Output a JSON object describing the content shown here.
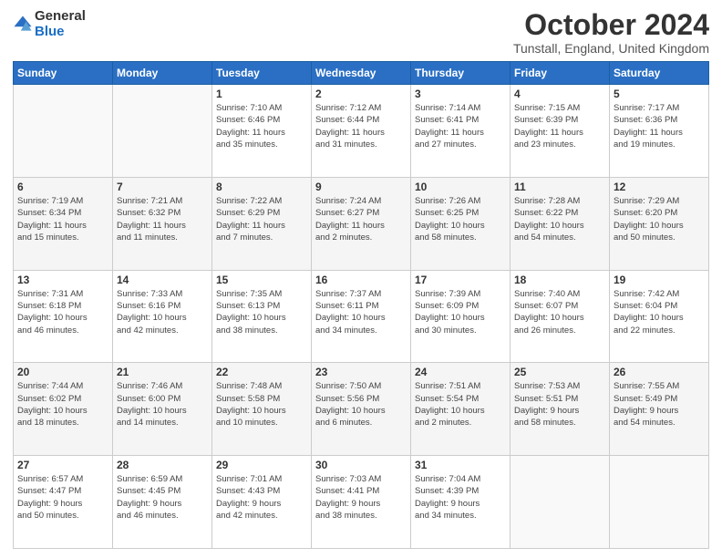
{
  "logo": {
    "general": "General",
    "blue": "Blue"
  },
  "title": "October 2024",
  "subtitle": "Tunstall, England, United Kingdom",
  "days_of_week": [
    "Sunday",
    "Monday",
    "Tuesday",
    "Wednesday",
    "Thursday",
    "Friday",
    "Saturday"
  ],
  "weeks": [
    [
      {
        "day": "",
        "info": ""
      },
      {
        "day": "",
        "info": ""
      },
      {
        "day": "1",
        "info": "Sunrise: 7:10 AM\nSunset: 6:46 PM\nDaylight: 11 hours\nand 35 minutes."
      },
      {
        "day": "2",
        "info": "Sunrise: 7:12 AM\nSunset: 6:44 PM\nDaylight: 11 hours\nand 31 minutes."
      },
      {
        "day": "3",
        "info": "Sunrise: 7:14 AM\nSunset: 6:41 PM\nDaylight: 11 hours\nand 27 minutes."
      },
      {
        "day": "4",
        "info": "Sunrise: 7:15 AM\nSunset: 6:39 PM\nDaylight: 11 hours\nand 23 minutes."
      },
      {
        "day": "5",
        "info": "Sunrise: 7:17 AM\nSunset: 6:36 PM\nDaylight: 11 hours\nand 19 minutes."
      }
    ],
    [
      {
        "day": "6",
        "info": "Sunrise: 7:19 AM\nSunset: 6:34 PM\nDaylight: 11 hours\nand 15 minutes."
      },
      {
        "day": "7",
        "info": "Sunrise: 7:21 AM\nSunset: 6:32 PM\nDaylight: 11 hours\nand 11 minutes."
      },
      {
        "day": "8",
        "info": "Sunrise: 7:22 AM\nSunset: 6:29 PM\nDaylight: 11 hours\nand 7 minutes."
      },
      {
        "day": "9",
        "info": "Sunrise: 7:24 AM\nSunset: 6:27 PM\nDaylight: 11 hours\nand 2 minutes."
      },
      {
        "day": "10",
        "info": "Sunrise: 7:26 AM\nSunset: 6:25 PM\nDaylight: 10 hours\nand 58 minutes."
      },
      {
        "day": "11",
        "info": "Sunrise: 7:28 AM\nSunset: 6:22 PM\nDaylight: 10 hours\nand 54 minutes."
      },
      {
        "day": "12",
        "info": "Sunrise: 7:29 AM\nSunset: 6:20 PM\nDaylight: 10 hours\nand 50 minutes."
      }
    ],
    [
      {
        "day": "13",
        "info": "Sunrise: 7:31 AM\nSunset: 6:18 PM\nDaylight: 10 hours\nand 46 minutes."
      },
      {
        "day": "14",
        "info": "Sunrise: 7:33 AM\nSunset: 6:16 PM\nDaylight: 10 hours\nand 42 minutes."
      },
      {
        "day": "15",
        "info": "Sunrise: 7:35 AM\nSunset: 6:13 PM\nDaylight: 10 hours\nand 38 minutes."
      },
      {
        "day": "16",
        "info": "Sunrise: 7:37 AM\nSunset: 6:11 PM\nDaylight: 10 hours\nand 34 minutes."
      },
      {
        "day": "17",
        "info": "Sunrise: 7:39 AM\nSunset: 6:09 PM\nDaylight: 10 hours\nand 30 minutes."
      },
      {
        "day": "18",
        "info": "Sunrise: 7:40 AM\nSunset: 6:07 PM\nDaylight: 10 hours\nand 26 minutes."
      },
      {
        "day": "19",
        "info": "Sunrise: 7:42 AM\nSunset: 6:04 PM\nDaylight: 10 hours\nand 22 minutes."
      }
    ],
    [
      {
        "day": "20",
        "info": "Sunrise: 7:44 AM\nSunset: 6:02 PM\nDaylight: 10 hours\nand 18 minutes."
      },
      {
        "day": "21",
        "info": "Sunrise: 7:46 AM\nSunset: 6:00 PM\nDaylight: 10 hours\nand 14 minutes."
      },
      {
        "day": "22",
        "info": "Sunrise: 7:48 AM\nSunset: 5:58 PM\nDaylight: 10 hours\nand 10 minutes."
      },
      {
        "day": "23",
        "info": "Sunrise: 7:50 AM\nSunset: 5:56 PM\nDaylight: 10 hours\nand 6 minutes."
      },
      {
        "day": "24",
        "info": "Sunrise: 7:51 AM\nSunset: 5:54 PM\nDaylight: 10 hours\nand 2 minutes."
      },
      {
        "day": "25",
        "info": "Sunrise: 7:53 AM\nSunset: 5:51 PM\nDaylight: 9 hours\nand 58 minutes."
      },
      {
        "day": "26",
        "info": "Sunrise: 7:55 AM\nSunset: 5:49 PM\nDaylight: 9 hours\nand 54 minutes."
      }
    ],
    [
      {
        "day": "27",
        "info": "Sunrise: 6:57 AM\nSunset: 4:47 PM\nDaylight: 9 hours\nand 50 minutes."
      },
      {
        "day": "28",
        "info": "Sunrise: 6:59 AM\nSunset: 4:45 PM\nDaylight: 9 hours\nand 46 minutes."
      },
      {
        "day": "29",
        "info": "Sunrise: 7:01 AM\nSunset: 4:43 PM\nDaylight: 9 hours\nand 42 minutes."
      },
      {
        "day": "30",
        "info": "Sunrise: 7:03 AM\nSunset: 4:41 PM\nDaylight: 9 hours\nand 38 minutes."
      },
      {
        "day": "31",
        "info": "Sunrise: 7:04 AM\nSunset: 4:39 PM\nDaylight: 9 hours\nand 34 minutes."
      },
      {
        "day": "",
        "info": ""
      },
      {
        "day": "",
        "info": ""
      }
    ]
  ]
}
